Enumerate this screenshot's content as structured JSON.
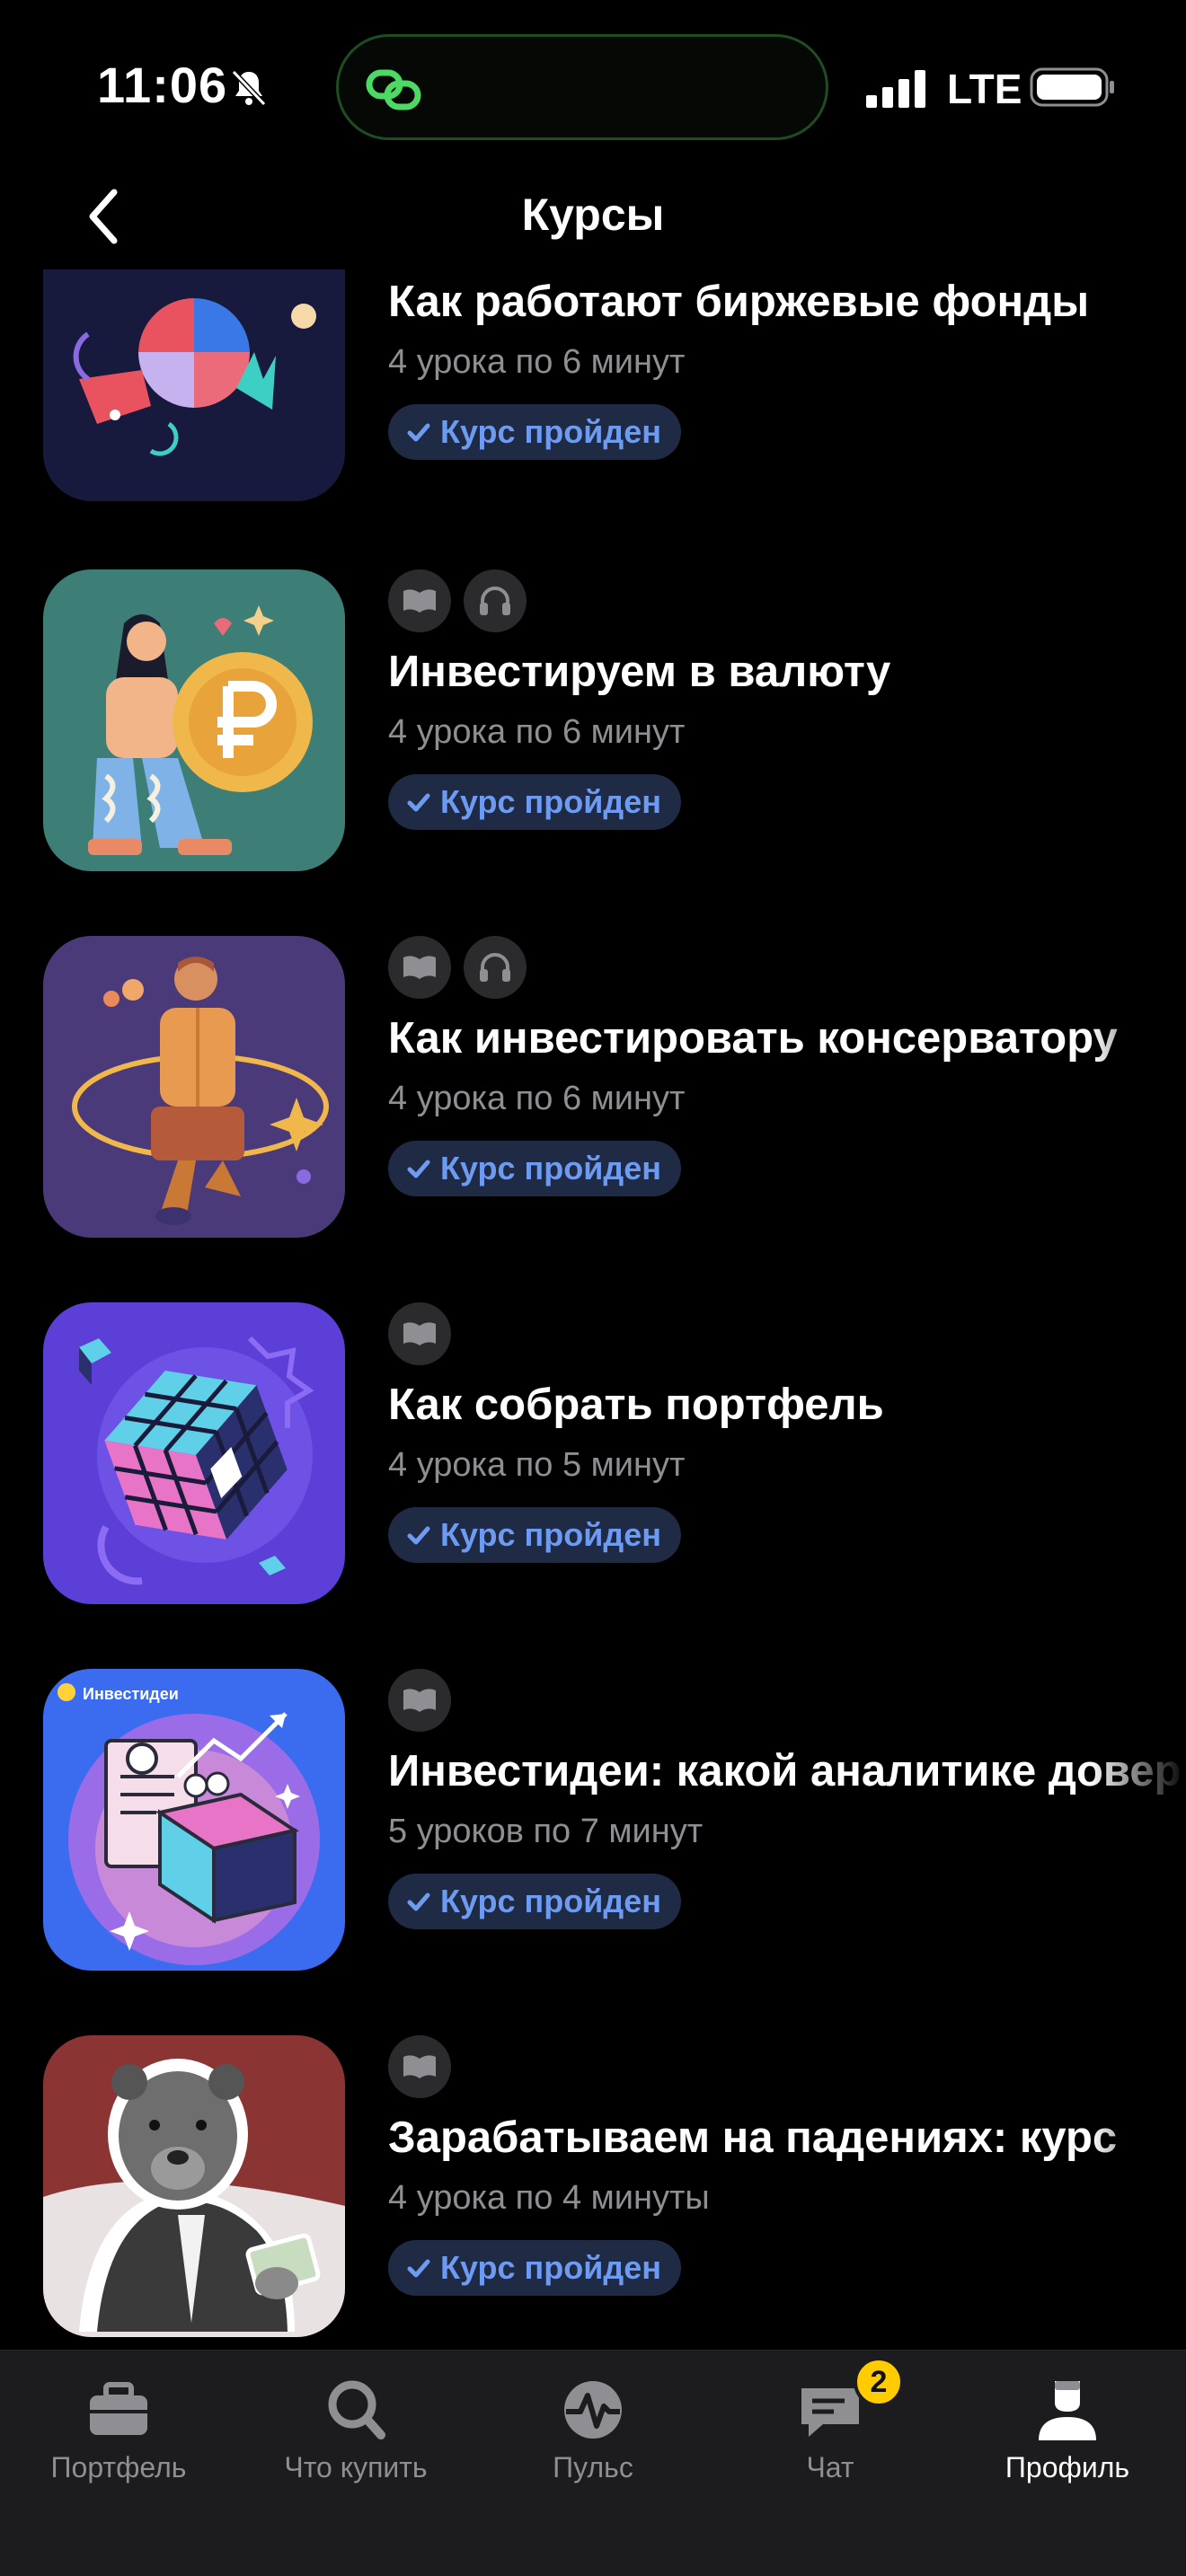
{
  "status": {
    "time": "11:06",
    "network": "LTE"
  },
  "nav": {
    "title": "Курсы"
  },
  "courses": [
    {
      "title": "Как работают биржевые фонды",
      "meta": "4 урока по 6 минут",
      "badge": "Курс пройден",
      "formats": []
    },
    {
      "title": "Инвестируем в валюту",
      "meta": "4 урока по 6 минут",
      "badge": "Курс пройден",
      "formats": [
        "book-icon",
        "headphones-icon"
      ]
    },
    {
      "title": "Как инвестировать консерватору",
      "meta": "4 урока по 6 минут",
      "badge": "Курс пройден",
      "formats": [
        "book-icon",
        "headphones-icon"
      ]
    },
    {
      "title": "Как собрать портфель",
      "meta": "4 урока по 5 минут",
      "badge": "Курс пройден",
      "formats": [
        "book-icon"
      ]
    },
    {
      "title": "Инвестидеи: какой аналитике довериться",
      "meta": "5 уроков по 7 минут",
      "badge": "Курс пройден",
      "formats": [
        "book-icon"
      ],
      "thumb_label": "Инвестидеи"
    },
    {
      "title": "Зарабатываем на падениях: курс",
      "meta": "4 урока по 4 минуты",
      "badge": "Курс пройден",
      "formats": [
        "book-icon"
      ]
    }
  ],
  "tabs": [
    {
      "label": "Портфель",
      "icon": "briefcase-icon"
    },
    {
      "label": "Что купить",
      "icon": "search-icon"
    },
    {
      "label": "Пульс",
      "icon": "pulse-icon"
    },
    {
      "label": "Чат",
      "icon": "chat-icon",
      "badge": "2"
    },
    {
      "label": "Профиль",
      "icon": "profile-icon",
      "active": true
    }
  ],
  "colors": {
    "background": "#000000",
    "badge_bg": "#1f2a45",
    "badge_text": "#6e9bf2",
    "tab_bar": "#1c1c1e",
    "chat_badge": "#ffcc00",
    "island_border": "#1e4d22",
    "island_icon": "#4cd964"
  }
}
